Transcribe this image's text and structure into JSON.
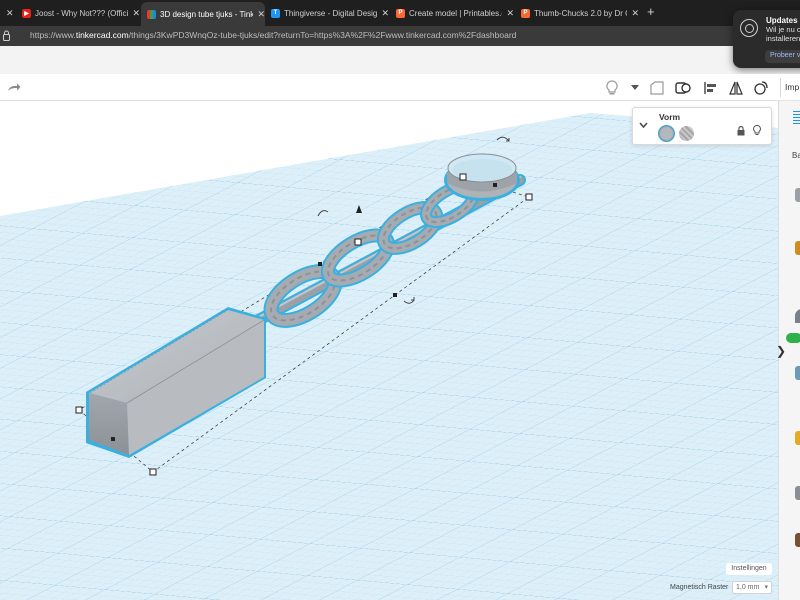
{
  "browser": {
    "tabs": [
      {
        "title": "",
        "icon": "close-icon",
        "color": "#1f1f1f"
      },
      {
        "title": "Joost - Why Not??? (Official Vid",
        "icon": "youtube-icon",
        "color": "#e62117"
      },
      {
        "title": "3D design tube tjuks - Tinkercad",
        "icon": "tinkercad-icon",
        "color": "#4caf50",
        "active": true
      },
      {
        "title": "Thingiverse - Digital Designs fo",
        "icon": "thingiverse-icon",
        "color": "#2196f3"
      },
      {
        "title": "Create model | Printables.com",
        "icon": "printables-icon",
        "color": "#fa6831"
      },
      {
        "title": "Thumb-Chucks 2.0 by Dr Opera",
        "icon": "printables-icon",
        "color": "#fa6831"
      }
    ],
    "new_tab": "+",
    "url_scheme": "https://www.",
    "url_host": "tinkercad.com",
    "url_path": "/things/3KwPD3WnqOz-tube-tjuks/edit?returnTo=https%3A%2F%2Fwww.tinkercad.com%2Fdashboard"
  },
  "notification": {
    "title": "Updates b",
    "line1": "Wil je nu o",
    "line2": "installeren",
    "button": "Probeer vanna"
  },
  "toolbar": {
    "redo_icon": "redo-icon",
    "import_label": "Imp"
  },
  "inspector": {
    "title": "Vorm",
    "chevron": "❯",
    "solid_label": "solid",
    "hole_label": "hole"
  },
  "right_panel": {
    "label": "Ba",
    "toggle": "❯"
  },
  "bottom": {
    "settings": "Instellingen",
    "snap_label": "Magnetisch Raster",
    "snap_value": "1,0 mm"
  },
  "colors": {
    "grid_fill": "#ddeff8",
    "grid_line": "#a9d3ea",
    "selection": "#3ab0e0",
    "shape_gray": "#a7adb3"
  }
}
